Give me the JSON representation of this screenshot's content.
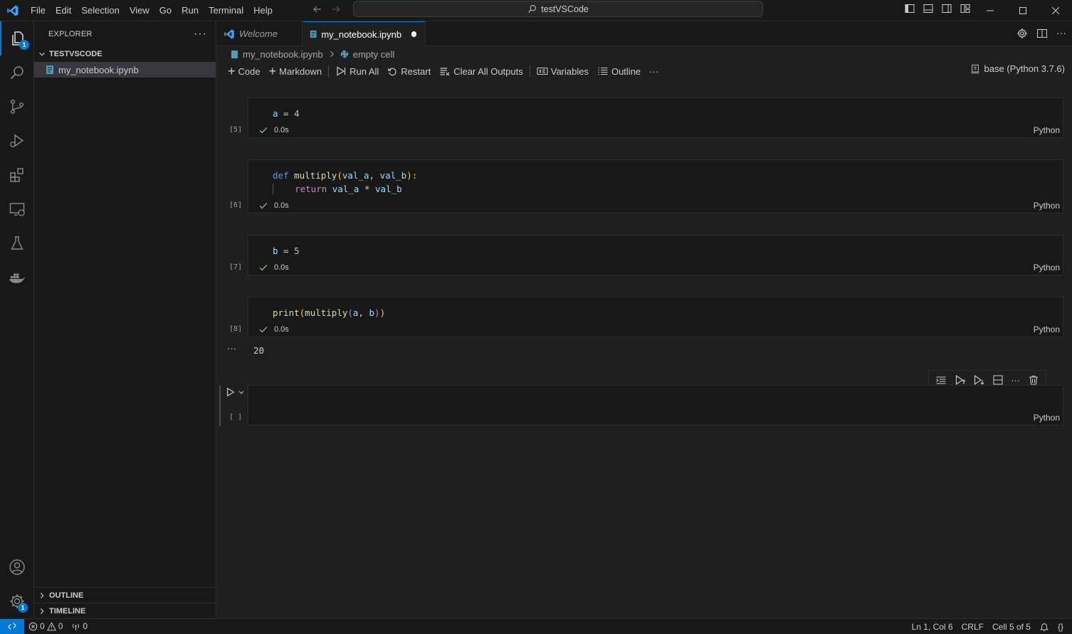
{
  "app": {
    "window_title": "testVSCode"
  },
  "menu": [
    "File",
    "Edit",
    "Selection",
    "View",
    "Go",
    "Run",
    "Terminal",
    "Help"
  ],
  "sidebar": {
    "title": "EXPLORER",
    "folder": "TESTVSCODE",
    "files": [
      {
        "name": "my_notebook.ipynb"
      }
    ],
    "outline_label": "OUTLINE",
    "timeline_label": "TIMELINE"
  },
  "activity": {
    "explorer_badge": "1",
    "settings_badge": "1"
  },
  "tabs": [
    {
      "label": "Welcome",
      "active": false
    },
    {
      "label": "my_notebook.ipynb",
      "active": true,
      "dirty": true
    }
  ],
  "breadcrumb": {
    "file": "my_notebook.ipynb",
    "cell": "empty cell"
  },
  "toolbar": {
    "code": "Code",
    "markdown": "Markdown",
    "run_all": "Run All",
    "restart": "Restart",
    "clear_outputs": "Clear All Outputs",
    "variables": "Variables",
    "outline": "Outline",
    "more": "···",
    "kernel": "base (Python 3.7.6)"
  },
  "cells": [
    {
      "exec": "[5]",
      "time": "0.0s",
      "lang": "Python"
    },
    {
      "exec": "[6]",
      "time": "0.0s",
      "lang": "Python"
    },
    {
      "exec": "[7]",
      "time": "0.0s",
      "lang": "Python"
    },
    {
      "exec": "[8]",
      "time": "0.0s",
      "lang": "Python",
      "output": "20",
      "output_more": "···"
    },
    {
      "exec": "[ ]",
      "lang": "Python"
    }
  ],
  "code": {
    "c1": {
      "a": "a",
      "eq": " = ",
      "v": "4"
    },
    "c2": {
      "def": "def",
      "fn": "multiply",
      "open": "(",
      "p1": "val_a",
      "comma": ", ",
      "p2": "val_b",
      "close": "):",
      "ret": "return",
      "r1": "val_a",
      "mul": " * ",
      "r2": "val_b"
    },
    "c3": {
      "b": "b",
      "eq": " = ",
      "v": "5"
    },
    "c4": {
      "print": "print",
      "o1": "(",
      "fn": "multiply",
      "o2": "(",
      "a": "a",
      "comma": ", ",
      "b": "b",
      "c2": ")",
      "c1": ")"
    }
  },
  "statusbar": {
    "errors": "0",
    "warnings": "0",
    "ports": "0",
    "position": "Ln 1, Col 6",
    "eol": "CRLF",
    "cell": "Cell 5 of 5"
  },
  "colors": {
    "accent": "#0078d4",
    "success": "#89d185"
  }
}
